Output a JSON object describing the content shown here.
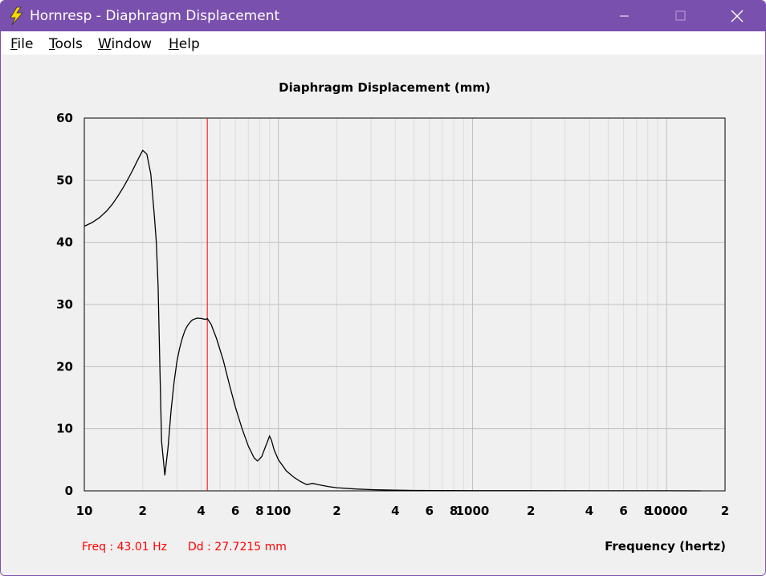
{
  "window": {
    "title": "Hornresp - Diaphragm Displacement",
    "titlebar_color": "#7a50ae"
  },
  "menu": {
    "file": "File",
    "tools": "Tools",
    "window": "Window",
    "help": "Help"
  },
  "controls": {
    "minimize_icon": "minimize-icon",
    "maximize_icon": "maximize-icon",
    "close_icon": "close-icon"
  },
  "status": {
    "freq": "Freq : 43.01 Hz",
    "dd": "Dd : 27.7215 mm",
    "color": "#ff0000"
  },
  "chart_data": {
    "type": "line",
    "title": "Diaphragm Displacement (mm)",
    "xlabel": "Frequency (hertz)",
    "ylabel": "",
    "xscale": "log",
    "xlim": [
      10,
      20000
    ],
    "ylim": [
      0,
      60
    ],
    "grid": true,
    "y_ticks": [
      0,
      10,
      20,
      30,
      40,
      50,
      60
    ],
    "x_ticks": [
      {
        "value": 10,
        "label": "10"
      },
      {
        "value": 20,
        "label": "2"
      },
      {
        "value": 40,
        "label": "4"
      },
      {
        "value": 60,
        "label": "6"
      },
      {
        "value": 80,
        "label": "8"
      },
      {
        "value": 100,
        "label": "100"
      },
      {
        "value": 200,
        "label": "2"
      },
      {
        "value": 400,
        "label": "4"
      },
      {
        "value": 600,
        "label": "6"
      },
      {
        "value": 800,
        "label": "8"
      },
      {
        "value": 1000,
        "label": "1000"
      },
      {
        "value": 2000,
        "label": "2"
      },
      {
        "value": 4000,
        "label": "4"
      },
      {
        "value": 6000,
        "label": "6"
      },
      {
        "value": 8000,
        "label": "8"
      },
      {
        "value": 10000,
        "label": "10000"
      },
      {
        "value": 20000,
        "label": "2"
      }
    ],
    "cursor": {
      "x": 43.01,
      "y": 27.7215,
      "color": "#ff0000"
    },
    "series": [
      {
        "color": "#000000",
        "x": [
          10,
          11,
          12,
          13,
          14,
          15,
          16,
          17,
          18,
          19,
          20,
          21,
          22,
          23,
          23.5,
          24,
          24.5,
          25,
          26,
          27,
          28,
          29,
          30,
          31,
          32,
          33,
          34,
          35,
          36,
          38,
          40,
          42,
          43.01,
          45,
          48,
          52,
          56,
          60,
          65,
          70,
          75,
          78,
          82,
          86,
          90,
          92,
          95,
          100,
          110,
          120,
          130,
          140,
          150,
          160,
          180,
          200,
          250,
          300,
          400,
          500,
          1000,
          2000,
          5000,
          10000,
          15000
        ],
        "y": [
          42.6,
          43.2,
          44.0,
          45.0,
          46.2,
          47.6,
          49.0,
          50.5,
          52.0,
          53.5,
          54.8,
          54.2,
          51.0,
          44.0,
          40.0,
          33.0,
          20.0,
          8.0,
          2.5,
          7.0,
          13.0,
          17.5,
          20.8,
          23.0,
          24.6,
          25.8,
          26.6,
          27.1,
          27.5,
          27.8,
          27.75,
          27.6,
          27.72,
          26.8,
          24.5,
          21.0,
          17.0,
          13.5,
          10.0,
          7.2,
          5.3,
          4.8,
          5.5,
          7.2,
          8.8,
          8.2,
          6.6,
          5.0,
          3.2,
          2.2,
          1.5,
          1.0,
          1.2,
          1.0,
          0.7,
          0.5,
          0.3,
          0.2,
          0.1,
          0.06,
          0.03,
          0.02,
          0.01,
          0.01,
          0.0
        ]
      }
    ]
  }
}
